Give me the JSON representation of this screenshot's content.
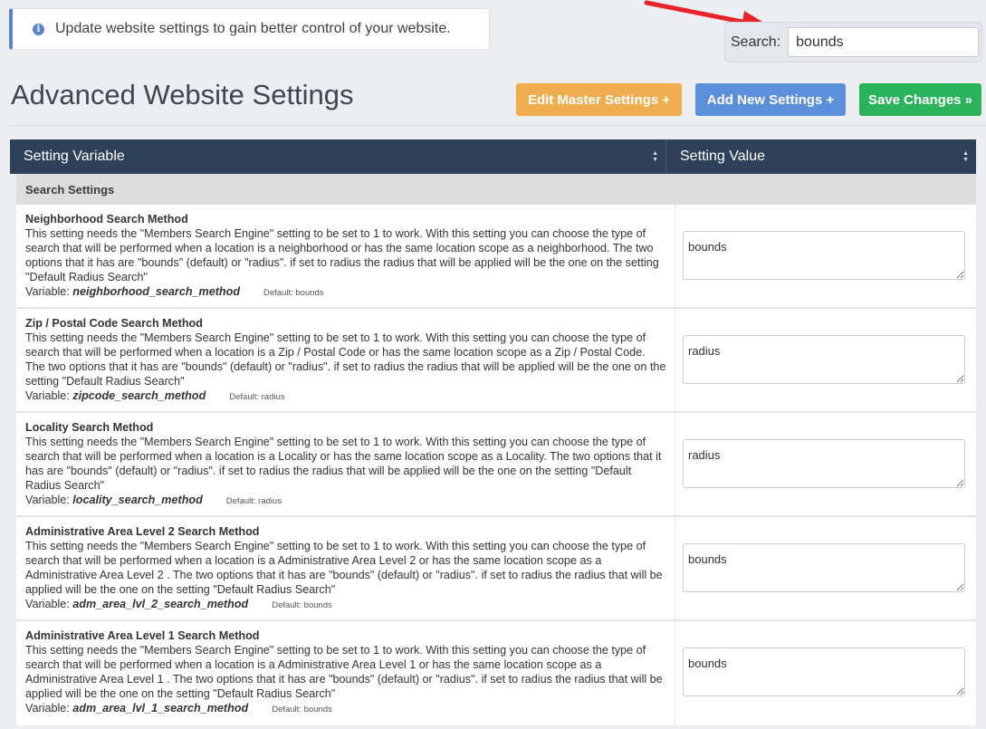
{
  "notice": {
    "text": "Update website settings to gain better control of your website.",
    "icon": "info-icon"
  },
  "search": {
    "label": "Search:",
    "value": "bounds"
  },
  "page_title": "Advanced Website Settings",
  "buttons": {
    "edit_master": "Edit Master Settings +",
    "add_new": "Add New Settings +",
    "save": "Save Changes »"
  },
  "colors": {
    "header": "#2e4158",
    "warning": "#f0ad4e",
    "primary": "#5b8fd9",
    "success": "#2ab35a",
    "annotation_arrow": "#e8242a"
  },
  "table": {
    "columns": [
      "Setting Variable",
      "Setting Value"
    ],
    "group": "Search Settings",
    "rows": [
      {
        "name": "Neighborhood Search Method",
        "description": "This setting needs the \"Members Search Engine\" setting to be set to 1 to work. With this setting you can choose the type of search that will be performed when a location is a neighborhood or has the same location scope as a neighborhood. The two options that it has are \"bounds\" (default) or \"radius\". if set to radius the radius that will be applied will be the one on the setting \"Default Radius Search\"",
        "variable_label": "Variable:",
        "variable": "neighborhood_search_method",
        "default": "Default: bounds",
        "value": "bounds"
      },
      {
        "name": "Zip / Postal Code Search Method",
        "description": "This setting needs the \"Members Search Engine\" setting to be set to 1 to work. With this setting you can choose the type of search that will be performed when a location is a Zip / Postal Code or has the same location scope as a Zip / Postal Code. The two options that it has are \"bounds\" (default) or \"radius\". if set to radius the radius that will be applied will be the one on the setting \"Default Radius Search\"",
        "variable_label": "Variable:",
        "variable": "zipcode_search_method",
        "default": "Default: radius",
        "value": "radius"
      },
      {
        "name": "Locality Search Method",
        "description": "This setting needs the \"Members Search Engine\" setting to be set to 1 to work. With this setting you can choose the type of search that will be performed when a location is a Locality or has the same location scope as a Locality. The two options that it has are \"bounds\" (default) or \"radius\". if set to radius the radius that will be applied will be the one on the setting \"Default Radius Search\"",
        "variable_label": "Variable:",
        "variable": "locality_search_method",
        "default": "Default: radius",
        "value": "radius"
      },
      {
        "name": "Administrative Area Level 2 Search Method",
        "description": "This setting needs the \"Members Search Engine\" setting to be set to 1 to work. With this setting you can choose the type of search that will be performed when a location is a Administrative Area Level 2 or has the same location scope as a Administrative Area Level 2 . The two options that it has are \"bounds\" (default) or \"radius\". if set to radius the radius that will be applied will be the one on the setting \"Default Radius Search\"",
        "variable_label": "Variable:",
        "variable": "adm_area_lvl_2_search_method",
        "default": "Default: bounds",
        "value": "bounds"
      },
      {
        "name": "Administrative Area Level 1 Search Method",
        "description": "This setting needs the \"Members Search Engine\" setting to be set to 1 to work. With this setting you can choose the type of search that will be performed when a location is a Administrative Area Level 1 or has the same location scope as a Administrative Area Level 1 . The two options that it has are \"bounds\" (default) or \"radius\". if set to radius the radius that will be applied will be the one on the setting \"Default Radius Search\"",
        "variable_label": "Variable:",
        "variable": "adm_area_lvl_1_search_method",
        "default": "Default: bounds",
        "value": "bounds"
      }
    ]
  }
}
